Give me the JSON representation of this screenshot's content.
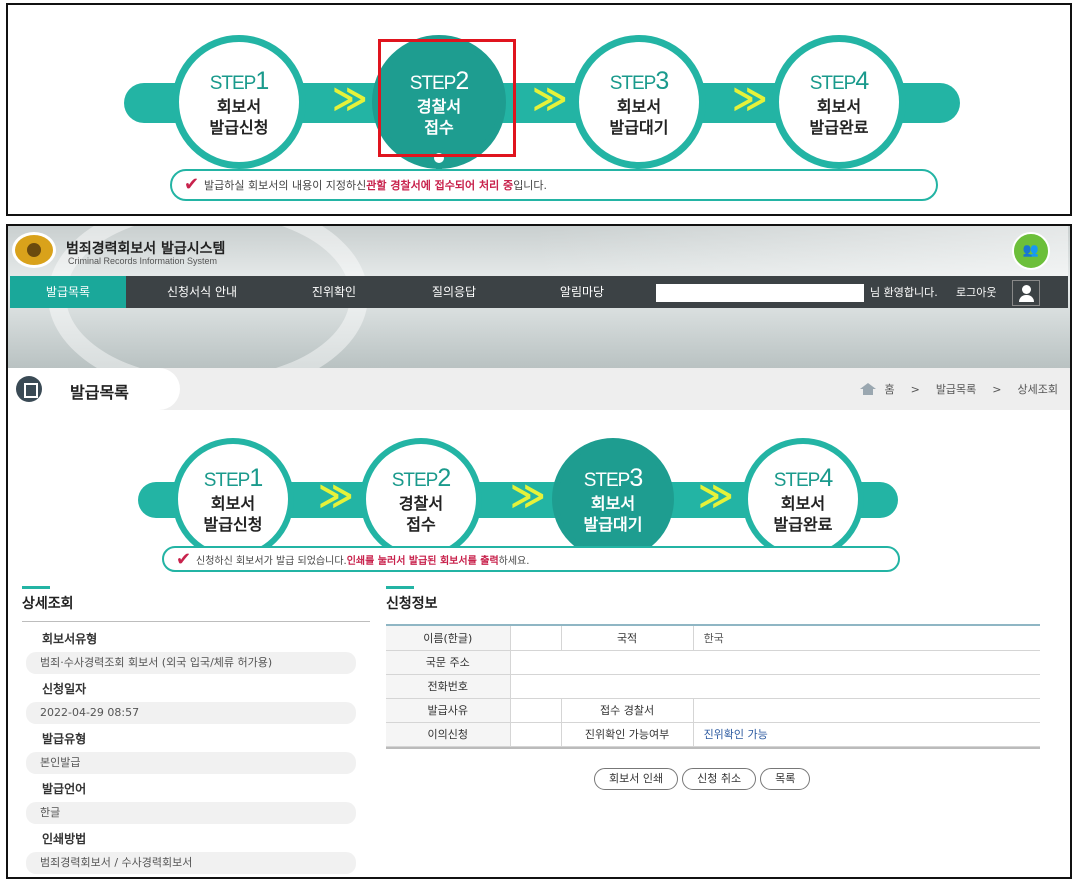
{
  "top_steps": {
    "steps": [
      {
        "label": "STEP",
        "num": "1",
        "line1": "회보서",
        "line2": "발급신청",
        "active": false
      },
      {
        "label": "STEP",
        "num": "2",
        "line1": "경찰서",
        "line2": "접수",
        "active": true
      },
      {
        "label": "STEP",
        "num": "3",
        "line1": "회보서",
        "line2": "발급대기",
        "active": false
      },
      {
        "label": "STEP",
        "num": "4",
        "line1": "회보서",
        "line2": "발급완료",
        "active": false
      }
    ],
    "message_pre": "발급하실 회보서의 내용이 지정하신 ",
    "message_hl": "관할 경찰서에 접수되어 처리 중",
    "message_post": "입니다.",
    "chevron": "≫",
    "check": "✔"
  },
  "header": {
    "system_title": "범죄경력회보서 발급시스템",
    "system_subtitle": "Criminal Records Information System",
    "badge": "👥",
    "nav": [
      "발급목록",
      "신청서식 안내",
      "진위확인",
      "질의응답",
      "알림마당"
    ],
    "welcome": "님 환영합니다.",
    "logout": "로그아웃"
  },
  "breadcrumb": {
    "page_title": "발급목록",
    "items": [
      "홈",
      "발급목록",
      "상세조회"
    ],
    "sep": ">"
  },
  "main_steps": {
    "steps": [
      {
        "label": "STEP",
        "num": "1",
        "line1": "회보서",
        "line2": "발급신청",
        "active": false
      },
      {
        "label": "STEP",
        "num": "2",
        "line1": "경찰서",
        "line2": "접수",
        "active": false
      },
      {
        "label": "STEP",
        "num": "3",
        "line1": "회보서",
        "line2": "발급대기",
        "active": true
      },
      {
        "label": "STEP",
        "num": "4",
        "line1": "회보서",
        "line2": "발급완료",
        "active": false
      }
    ],
    "message_pre": "신청하신 회보서가 발급 되었습니다.",
    "message_hl": "인쇄를 눌러서 발급된 회보서를 출력",
    "message_post": "하세요."
  },
  "detail": {
    "title": "상세조회",
    "items": [
      {
        "label": "회보서유형",
        "value": "범죄·수사경력조회 회보서 (외국 입국/체류 허가용)"
      },
      {
        "label": "신청일자",
        "value": "2022-04-29 08:57"
      },
      {
        "label": "발급유형",
        "value": "본인발급"
      },
      {
        "label": "발급언어",
        "value": "한글"
      },
      {
        "label": "인쇄방법",
        "value": "범죄경력회보서 / 수사경력회보서"
      }
    ]
  },
  "info": {
    "title": "신청정보",
    "rows": [
      {
        "h1": "이름(한글)",
        "v1": "",
        "h2": "국적",
        "v2": "한국"
      },
      {
        "h1": "국문 주소",
        "v1": ""
      },
      {
        "h1": "전화번호",
        "v1": ""
      },
      {
        "h1": "발급사유",
        "v1": "",
        "h2": "접수 경찰서",
        "v2": ""
      },
      {
        "h1": "이의신청",
        "v1": "",
        "h2": "진위확인 가능여부",
        "v2": "진위확인 가능"
      }
    ]
  },
  "buttons": {
    "print": "회보서 인쇄",
    "cancel": "신청 취소",
    "list": "목록"
  },
  "colors": {
    "teal": "#23b4a4",
    "teal_dark": "#1e9d90",
    "chevron": "#e6f23a",
    "highlight": "#c8224c",
    "nav_bg": "#3c4245",
    "highlight_box": "#e0141e"
  }
}
